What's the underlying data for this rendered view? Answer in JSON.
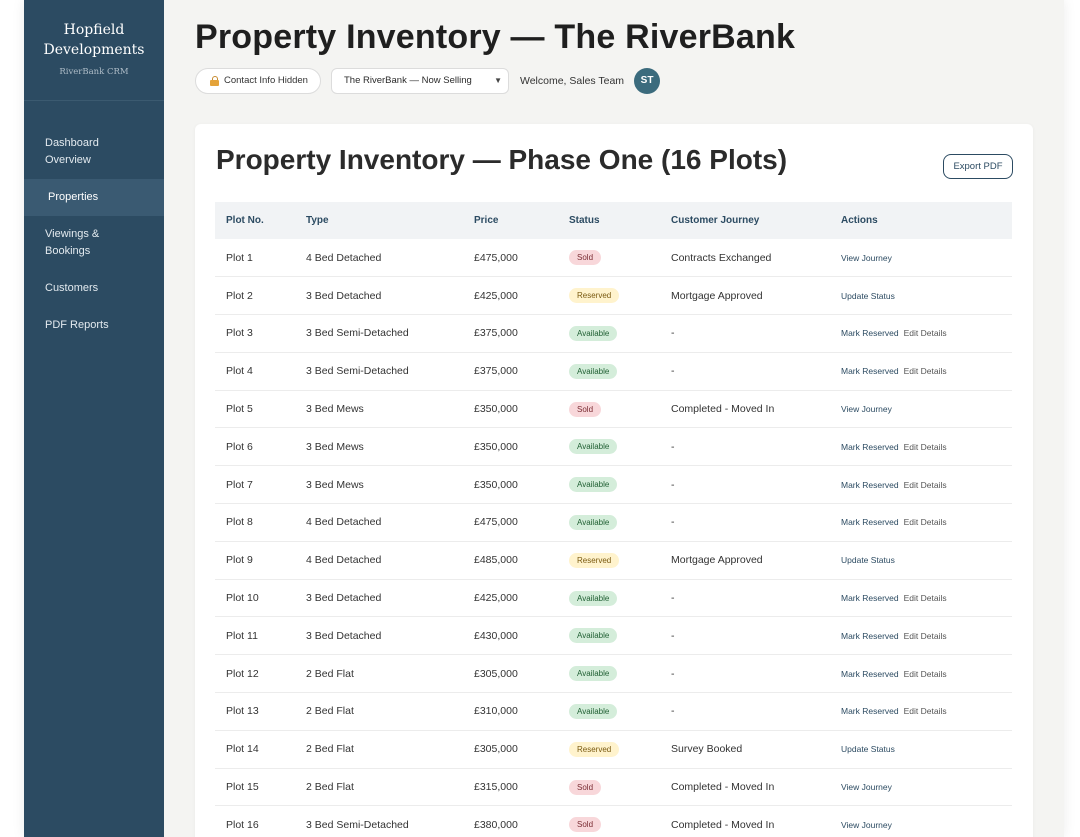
{
  "sidebar": {
    "brand_line1": "Hopfield",
    "brand_line2": "Developments",
    "brand_sub": "RiverBank CRM",
    "items": [
      {
        "label": "Dashboard Overview"
      },
      {
        "label": "Properties"
      },
      {
        "label": "Viewings & Bookings"
      },
      {
        "label": "Customers"
      },
      {
        "label": "PDF Reports"
      }
    ]
  },
  "header": {
    "title": "Property Inventory — The RiverBank",
    "contact_toggle": "Contact Info Hidden",
    "selected_development": "The RiverBank — Now Selling",
    "welcome": "Welcome, Sales Team",
    "avatar_initials": "ST"
  },
  "card": {
    "title": "Property Inventory — Phase One (16 Plots)",
    "export_label": "Export PDF"
  },
  "table": {
    "headers": [
      "Plot No.",
      "Type",
      "Price",
      "Status",
      "Customer Journey",
      "Actions"
    ],
    "rows": [
      {
        "plot": "Plot 1",
        "type": "4 Bed Detached",
        "price": "£475,000",
        "status": "Sold",
        "journey": "Contracts Exchanged",
        "actions": [
          "View Journey"
        ]
      },
      {
        "plot": "Plot 2",
        "type": "3 Bed Detached",
        "price": "£425,000",
        "status": "Reserved",
        "journey": "Mortgage Approved",
        "actions": [
          "Update Status"
        ]
      },
      {
        "plot": "Plot 3",
        "type": "3 Bed Semi-Detached",
        "price": "£375,000",
        "status": "Available",
        "journey": "-",
        "actions": [
          "Mark Reserved",
          "Edit Details"
        ]
      },
      {
        "plot": "Plot 4",
        "type": "3 Bed Semi-Detached",
        "price": "£375,000",
        "status": "Available",
        "journey": "-",
        "actions": [
          "Mark Reserved",
          "Edit Details"
        ]
      },
      {
        "plot": "Plot 5",
        "type": "3 Bed Mews",
        "price": "£350,000",
        "status": "Sold",
        "journey": "Completed - Moved In",
        "actions": [
          "View Journey"
        ]
      },
      {
        "plot": "Plot 6",
        "type": "3 Bed Mews",
        "price": "£350,000",
        "status": "Available",
        "journey": "-",
        "actions": [
          "Mark Reserved",
          "Edit Details"
        ]
      },
      {
        "plot": "Plot 7",
        "type": "3 Bed Mews",
        "price": "£350,000",
        "status": "Available",
        "journey": "-",
        "actions": [
          "Mark Reserved",
          "Edit Details"
        ]
      },
      {
        "plot": "Plot 8",
        "type": "4 Bed Detached",
        "price": "£475,000",
        "status": "Available",
        "journey": "-",
        "actions": [
          "Mark Reserved",
          "Edit Details"
        ]
      },
      {
        "plot": "Plot 9",
        "type": "4 Bed Detached",
        "price": "£485,000",
        "status": "Reserved",
        "journey": "Mortgage Approved",
        "actions": [
          "Update Status"
        ]
      },
      {
        "plot": "Plot 10",
        "type": "3 Bed Detached",
        "price": "£425,000",
        "status": "Available",
        "journey": "-",
        "actions": [
          "Mark Reserved",
          "Edit Details"
        ]
      },
      {
        "plot": "Plot 11",
        "type": "3 Bed Detached",
        "price": "£430,000",
        "status": "Available",
        "journey": "-",
        "actions": [
          "Mark Reserved",
          "Edit Details"
        ]
      },
      {
        "plot": "Plot 12",
        "type": "2 Bed Flat",
        "price": "£305,000",
        "status": "Available",
        "journey": "-",
        "actions": [
          "Mark Reserved",
          "Edit Details"
        ]
      },
      {
        "plot": "Plot 13",
        "type": "2 Bed Flat",
        "price": "£310,000",
        "status": "Available",
        "journey": "-",
        "actions": [
          "Mark Reserved",
          "Edit Details"
        ]
      },
      {
        "plot": "Plot 14",
        "type": "2 Bed Flat",
        "price": "£305,000",
        "status": "Reserved",
        "journey": "Survey Booked",
        "actions": [
          "Update Status"
        ]
      },
      {
        "plot": "Plot 15",
        "type": "2 Bed Flat",
        "price": "£315,000",
        "status": "Sold",
        "journey": "Completed - Moved In",
        "actions": [
          "View Journey"
        ]
      },
      {
        "plot": "Plot 16",
        "type": "3 Bed Semi-Detached",
        "price": "£380,000",
        "status": "Sold",
        "journey": "Completed - Moved In",
        "actions": [
          "View Journey"
        ]
      }
    ]
  },
  "colors": {
    "sidebar_bg": "#2c4b62",
    "accent": "#2c4b62",
    "sold_bg": "#f8d7da",
    "reserved_bg": "#fff3cd",
    "available_bg": "#d4edda",
    "avatar_bg": "#3b6b7d"
  },
  "icons": {
    "contact_toggle": "lock-icon",
    "select_caret": "chevron-down-icon"
  }
}
